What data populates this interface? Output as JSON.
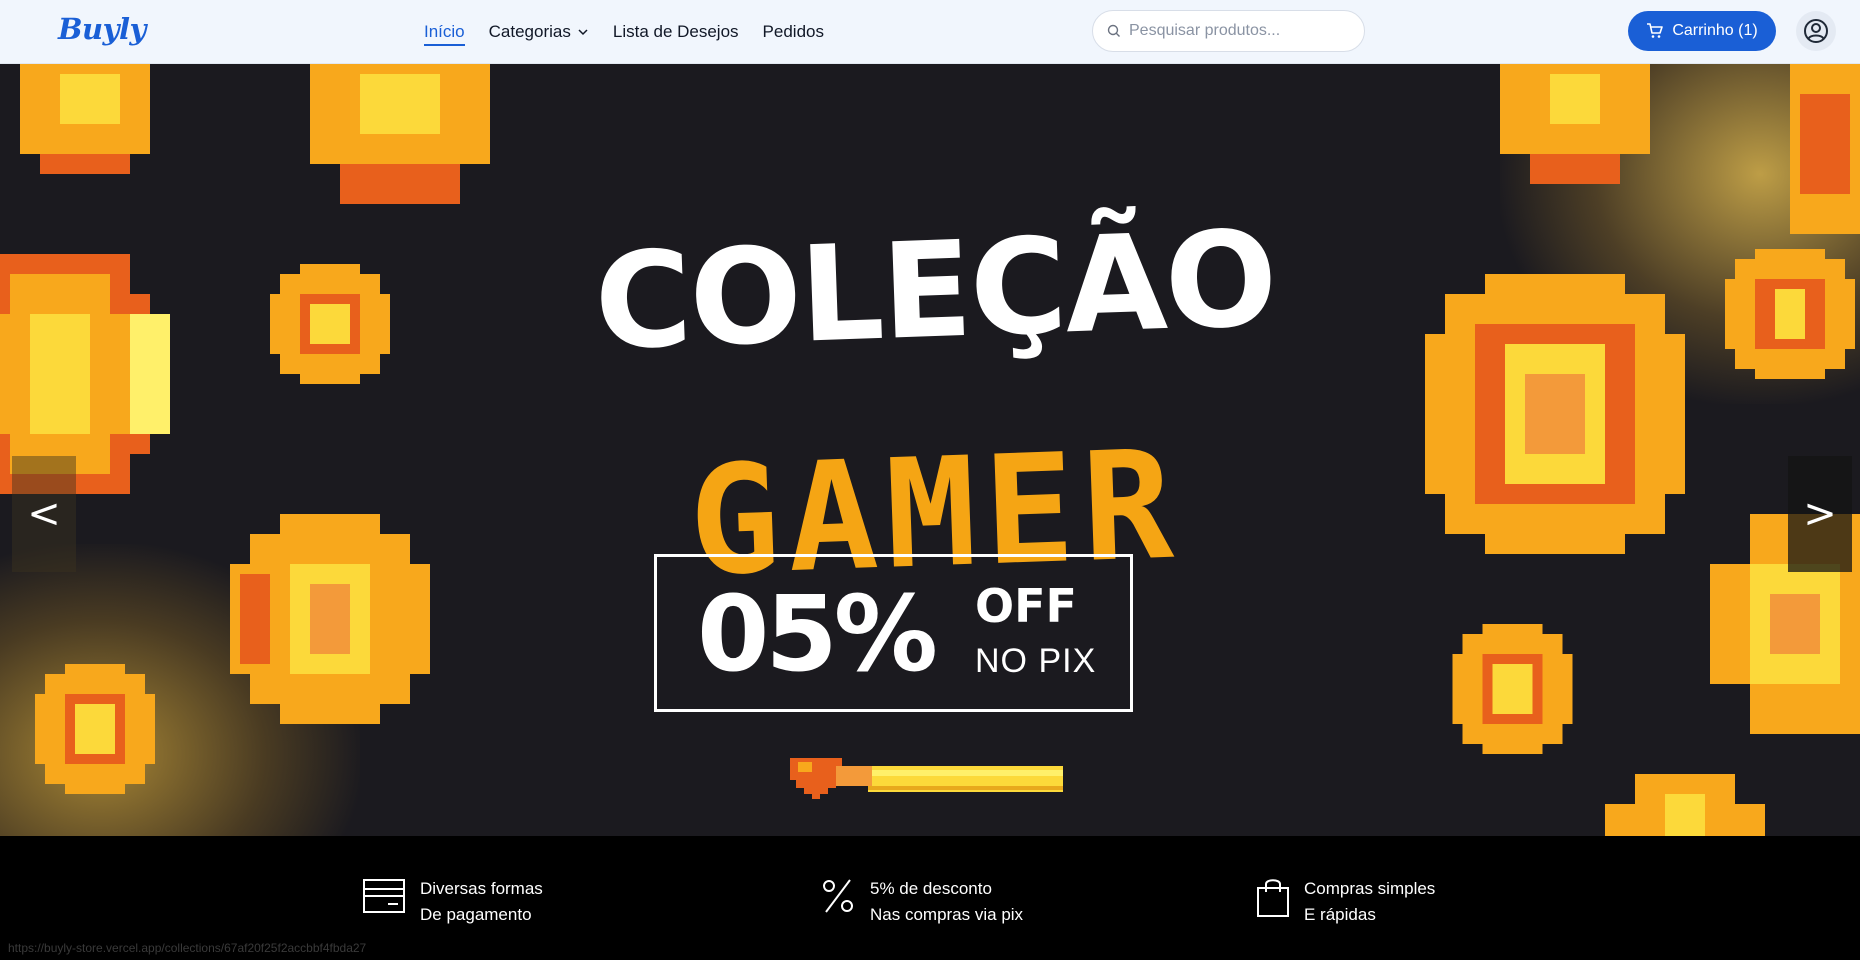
{
  "header": {
    "logo": "Buyly",
    "nav": [
      {
        "label": "Início",
        "active": true
      },
      {
        "label": "Categorias",
        "has_dropdown": true
      },
      {
        "label": "Lista de Desejos"
      },
      {
        "label": "Pedidos"
      }
    ],
    "search_placeholder": "Pesquisar produtos...",
    "cart_label": "Carrinho (1)"
  },
  "banner": {
    "line1": "COLEÇÃO",
    "line2": "GAMER",
    "discount": "05%",
    "off": "OFF",
    "pix": "NO PIX",
    "prev": "<",
    "next": ">"
  },
  "features": [
    {
      "icon": "credit-card-icon",
      "line1": "Diversas formas",
      "line2": "De pagamento"
    },
    {
      "icon": "percent-icon",
      "line1": "5% de desconto",
      "line2": "Nas compras via pix"
    },
    {
      "icon": "shopping-bag-icon",
      "line1": "Compras simples",
      "line2": "E rápidas"
    }
  ],
  "status_url": "https://buyly-store.vercel.app/collections/67af20f25f2accbbf4fbda27",
  "colors": {
    "accent": "#1a5fd6",
    "banner_bg": "#1b1a1f",
    "gamer_orange": "#f5a514"
  }
}
